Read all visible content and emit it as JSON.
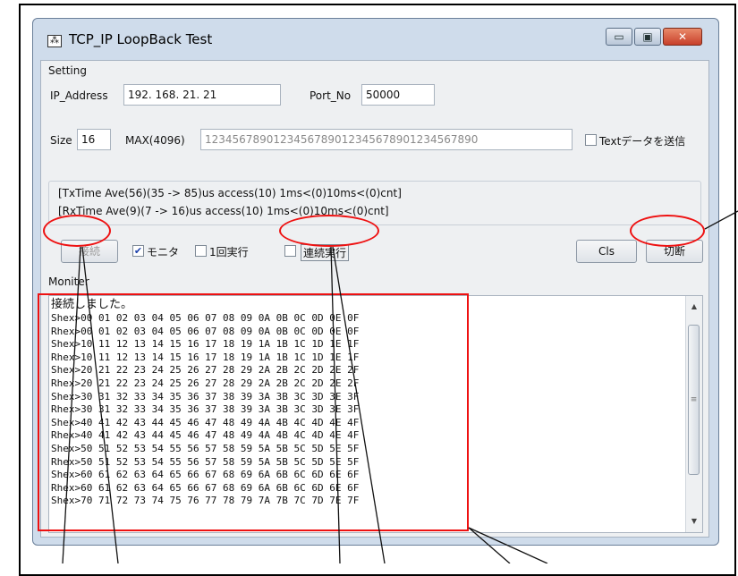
{
  "window": {
    "title": "TCP_IP LoopBack Test",
    "min_glyph": "▭",
    "max_glyph": "▣",
    "close_glyph": "✕",
    "app_icon_glyph": "⁂"
  },
  "setting": {
    "group_label": "Setting",
    "ip_label": "IP_Address",
    "ip_value": "192. 168. 21. 21",
    "port_label": "Port_No",
    "port_value": "50000",
    "size_label": "Size",
    "size_value": "16",
    "max_label": "MAX(4096)",
    "max_value": "1234567890123456789012345678901234567890",
    "text_send_label": "Textデータを送信"
  },
  "stats": {
    "tx": "[TxTime Ave(56)(35 -> 85)us access(10) 1ms<(0)10ms<(0)cnt]",
    "rx": "[RxTime Ave(9)(7 -> 16)us access(10) 1ms<(0)10ms<(0)cnt]"
  },
  "controls": {
    "connect_label": "接続",
    "monitor_label": "モニタ",
    "monitor_checked": true,
    "once_label": "1回実行",
    "continuous_label": "連続実行",
    "cls_label": "Cls",
    "disconnect_label": "切断"
  },
  "monitor": {
    "label": "Moniter",
    "lines": [
      "接続しました。",
      "Shex>00 01 02 03 04 05 06 07 08 09 0A 0B 0C 0D 0E 0F",
      "Rhex>00 01 02 03 04 05 06 07 08 09 0A 0B 0C 0D 0E 0F",
      "Shex>10 11 12 13 14 15 16 17 18 19 1A 1B 1C 1D 1E 1F",
      "Rhex>10 11 12 13 14 15 16 17 18 19 1A 1B 1C 1D 1E 1F",
      "Shex>20 21 22 23 24 25 26 27 28 29 2A 2B 2C 2D 2E 2F",
      "Rhex>20 21 22 23 24 25 26 27 28 29 2A 2B 2C 2D 2E 2F",
      "Shex>30 31 32 33 34 35 36 37 38 39 3A 3B 3C 3D 3E 3F",
      "Rhex>30 31 32 33 34 35 36 37 38 39 3A 3B 3C 3D 3E 3F",
      "Shex>40 41 42 43 44 45 46 47 48 49 4A 4B 4C 4D 4E 4F",
      "Rhex>40 41 42 43 44 45 46 47 48 49 4A 4B 4C 4D 4E 4F",
      "Shex>50 51 52 53 54 55 56 57 58 59 5A 5B 5C 5D 5E 5F",
      "Rhex>50 51 52 53 54 55 56 57 58 59 5A 5B 5C 5D 5E 5F",
      "Shex>60 61 62 63 64 65 66 67 68 69 6A 6B 6C 6D 6E 6F",
      "Rhex>60 61 62 63 64 65 66 67 68 69 6A 6B 6C 6D 6E 6F",
      "Shex>70 71 72 73 74 75 76 77 78 79 7A 7B 7C 7D 7E 7F"
    ],
    "scroll_up_glyph": "▲",
    "scroll_down_glyph": "▼",
    "grip_glyph": "≡"
  },
  "colors": {
    "annotation": "#e11111",
    "window_frame": "#cfdceb",
    "close_button": "#c8402a"
  }
}
